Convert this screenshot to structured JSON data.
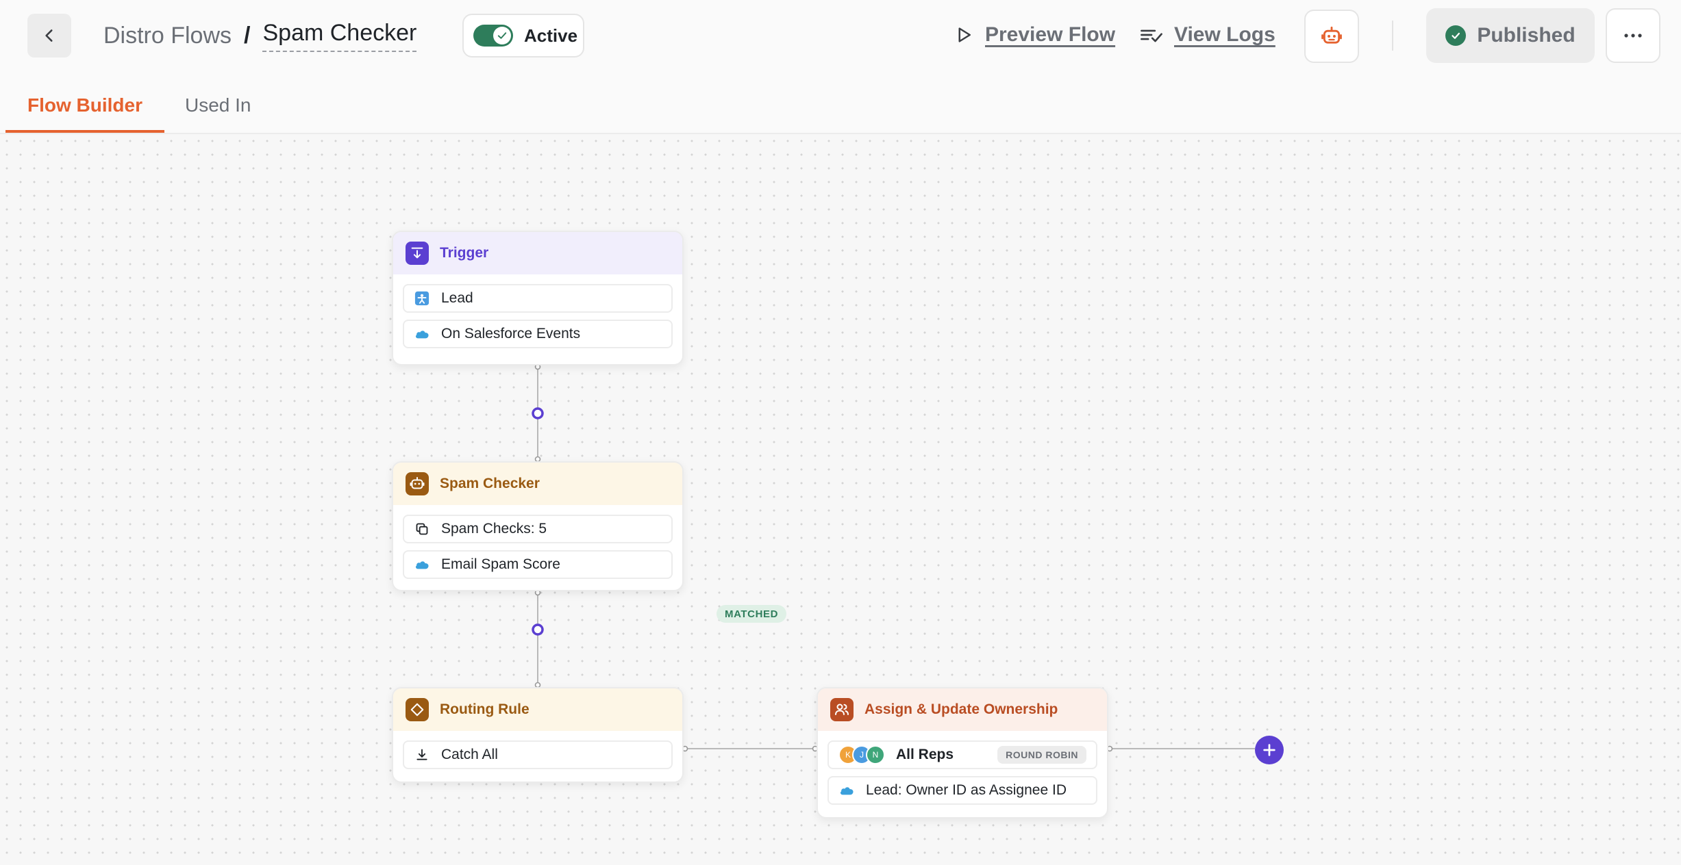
{
  "header": {
    "breadcrumb_parent": "Distro Flows",
    "breadcrumb_separator": "/",
    "breadcrumb_current": "Spam Checker",
    "toggle_label": "Active",
    "toggle_on": true,
    "preview_label": "Preview Flow",
    "logs_label": "View Logs",
    "published_label": "Published",
    "more_label": "···"
  },
  "tabs": [
    {
      "label": "Flow Builder",
      "active": true
    },
    {
      "label": "Used In",
      "active": false
    }
  ],
  "nodes": {
    "trigger": {
      "title": "Trigger",
      "rows": [
        "Lead",
        "On Salesforce Events"
      ]
    },
    "spam_checker": {
      "title": "Spam Checker",
      "rows": [
        "Spam Checks: 5",
        "Email Spam Score"
      ]
    },
    "routing_rule": {
      "title": "Routing Rule",
      "rows": [
        "Catch All"
      ]
    },
    "assign": {
      "title": "Assign & Update Ownership",
      "reps_label": "All Reps",
      "avatars": [
        "K",
        "J",
        "N"
      ],
      "method_badge": "ROUND ROBIN",
      "update_row": "Lead: Owner ID as Assignee ID"
    }
  },
  "edge_label": "MATCHED",
  "colors": {
    "accent": "#e5622f",
    "purple": "#5b3fd1",
    "green": "#2e7d5b",
    "salesforce_blue": "#3aa0dc"
  }
}
